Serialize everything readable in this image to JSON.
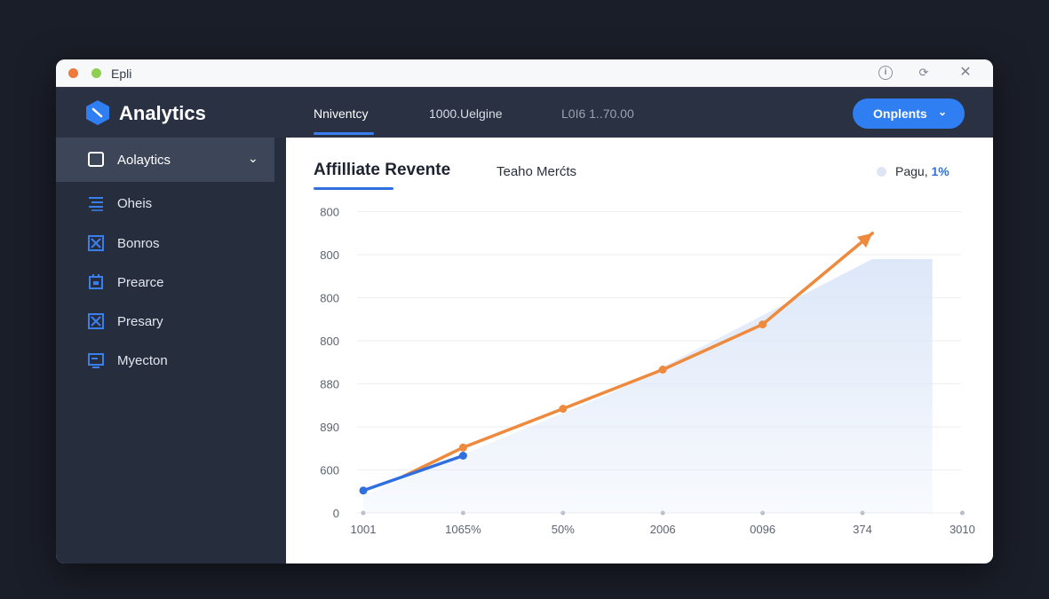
{
  "window": {
    "title": "Epli"
  },
  "titlebar_icons": [
    "info-icon",
    "refresh-icon",
    "close-icon"
  ],
  "app": {
    "name": "Analytics"
  },
  "top_tabs": [
    {
      "label": "Nniventcy",
      "active": true
    },
    {
      "label": "1000.Uelgine",
      "active": false
    },
    {
      "label": "L0I6 1..70.00",
      "active": false
    }
  ],
  "options_button": {
    "label": "Onplents"
  },
  "sidebar": {
    "active": {
      "label": "Aolaytics",
      "icon": "dashboard-icon"
    },
    "items": [
      {
        "label": "Oheis",
        "icon": "list-icon"
      },
      {
        "label": "Bonros",
        "icon": "box-x-icon"
      },
      {
        "label": "Prearce",
        "icon": "frame-icon"
      },
      {
        "label": "Presary",
        "icon": "box-x-icon"
      },
      {
        "label": "Myecton",
        "icon": "monitor-icon"
      }
    ]
  },
  "panel": {
    "title": "Affilliate Revente",
    "subtitle": "Teaho Merćts",
    "legend": {
      "text": "Pagu,",
      "value": "1%"
    }
  },
  "colors": {
    "accent": "#2f7ef2",
    "orange": "#ee8a3e",
    "blue_series": "#2f6fe0",
    "area": "#dbe6f8"
  },
  "chart_data": {
    "type": "line",
    "y_tick_labels": [
      "800",
      "800",
      "800",
      "800",
      "880",
      "890",
      "600",
      "0"
    ],
    "x_tick_labels": [
      "1001",
      "1065%",
      "50%",
      "2006",
      "0096",
      "374",
      "3010"
    ],
    "series": [
      {
        "color": "#ee8a3e",
        "points": [
          [
            0.4,
            0.85
          ],
          [
            1,
            1.52
          ],
          [
            2,
            2.42
          ],
          [
            3,
            3.33
          ],
          [
            4,
            4.38
          ],
          [
            5.1,
            6.5
          ]
        ]
      },
      {
        "color": "#2f6fe0",
        "points": [
          [
            0,
            0.52
          ],
          [
            1,
            1.33
          ]
        ]
      },
      {
        "color": "#dbe6f8",
        "area": true,
        "points": [
          [
            0,
            0.4
          ],
          [
            2.5,
            2.8
          ],
          [
            5.1,
            5.9
          ],
          [
            5.7,
            5.9
          ]
        ]
      }
    ],
    "grid": true
  }
}
